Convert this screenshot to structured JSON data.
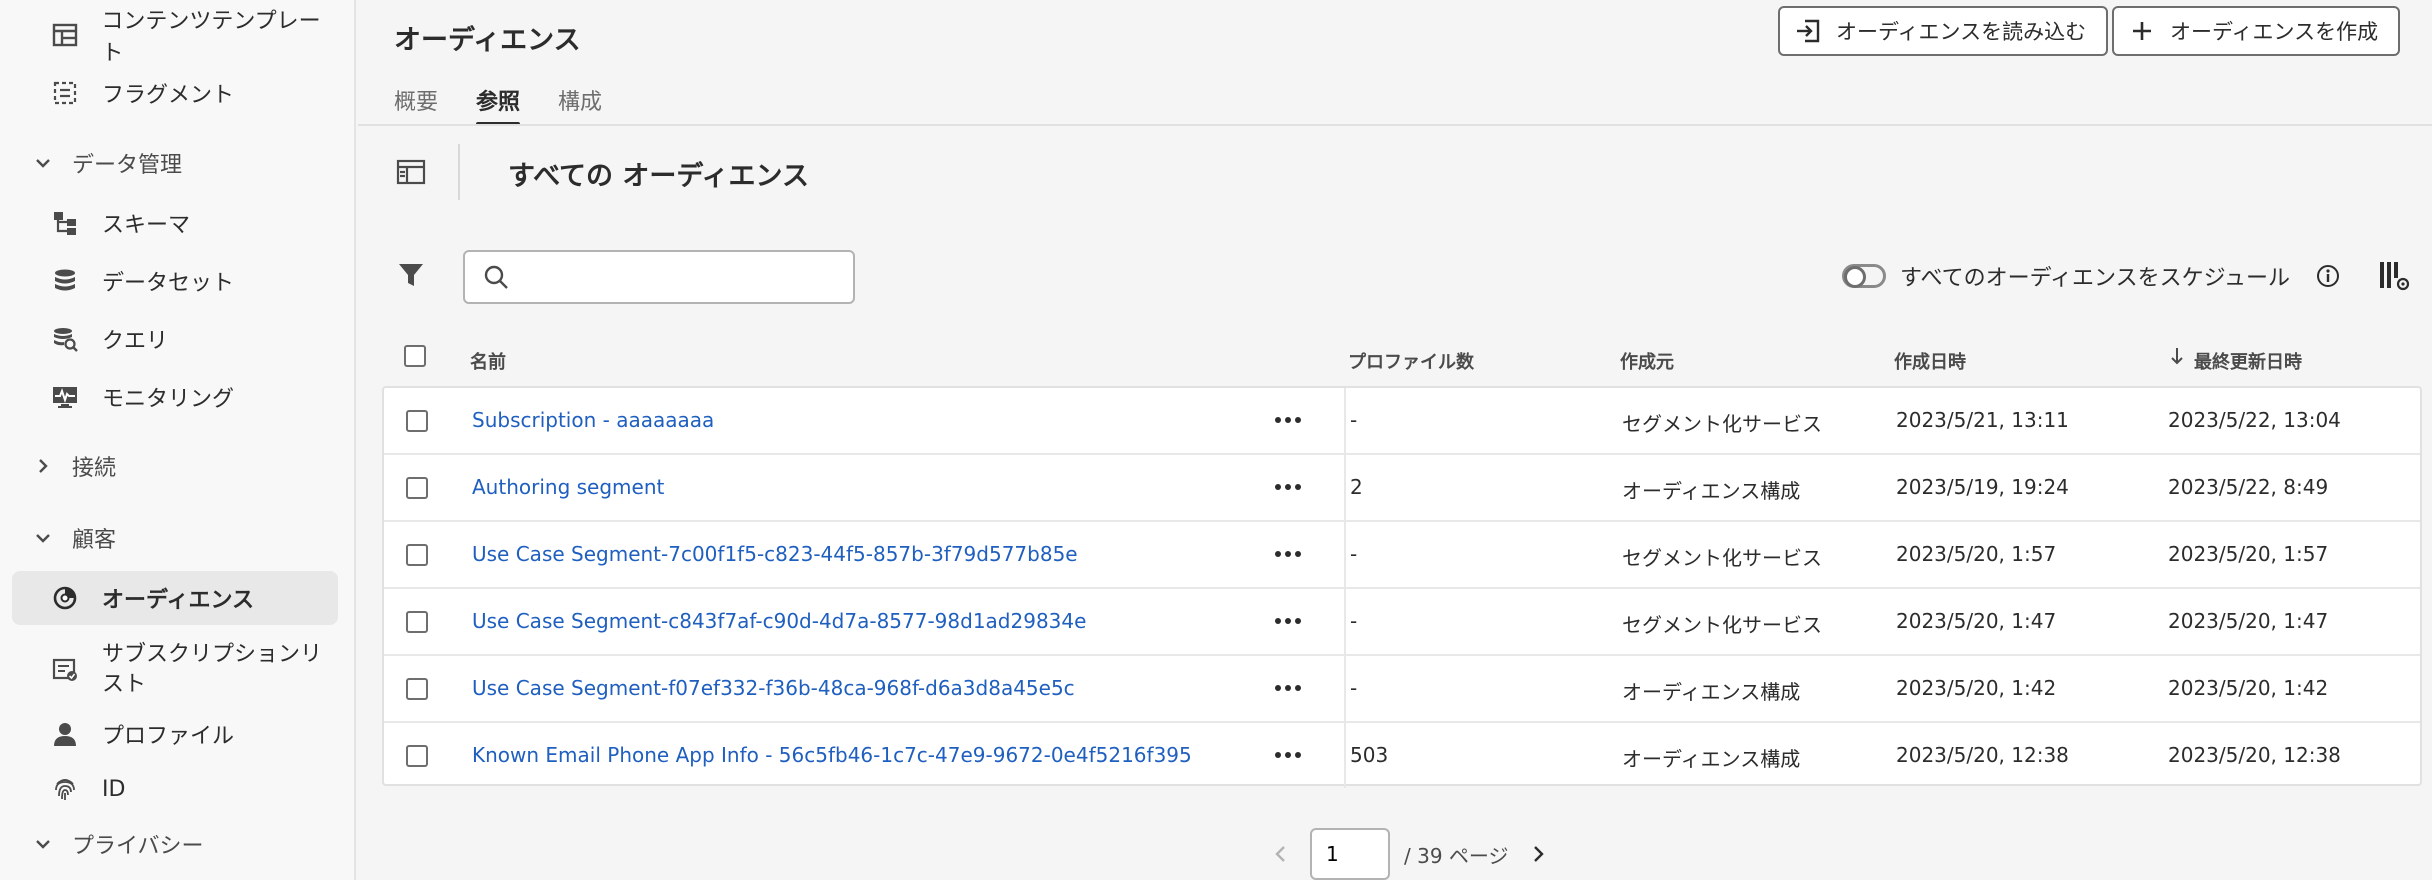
{
  "sidebar": {
    "items": [
      {
        "id": "content-templates",
        "label": "コンテンツテンプレート"
      },
      {
        "id": "fragments",
        "label": "フラグメント"
      },
      {
        "id": "section-data",
        "label": "データ管理"
      },
      {
        "id": "schemas",
        "label": "スキーマ"
      },
      {
        "id": "datasets",
        "label": "データセット"
      },
      {
        "id": "queries",
        "label": "クエリ"
      },
      {
        "id": "monitoring",
        "label": "モニタリング"
      },
      {
        "id": "section-connections",
        "label": "接続"
      },
      {
        "id": "section-customer",
        "label": "顧客"
      },
      {
        "id": "audiences",
        "label": "オーディエンス"
      },
      {
        "id": "subscription-lists",
        "label": "サブスクリプションリスト"
      },
      {
        "id": "profiles",
        "label": "プロファイル"
      },
      {
        "id": "identities",
        "label": "ID"
      },
      {
        "id": "section-privacy",
        "label": "プライバシー"
      }
    ]
  },
  "header": {
    "title": "オーディエンス",
    "import_button": "オーディエンスを読み込む",
    "create_button": "オーディエンスを作成"
  },
  "tabs": [
    {
      "label": "概要",
      "active": false
    },
    {
      "label": "参照",
      "active": true
    },
    {
      "label": "構成",
      "active": false
    }
  ],
  "toolbar": {
    "section_title": "すべての オーディエンス",
    "search_placeholder": "",
    "schedule_label": "すべてのオーディエンスをスケジュール"
  },
  "table": {
    "columns": {
      "name": "名前",
      "profiles": "プロファイル数",
      "origin": "作成元",
      "created": "作成日時",
      "updated": "最終更新日時"
    },
    "rows": [
      {
        "name": "Subscription - aaaaaaaa",
        "profiles": "-",
        "origin": "セグメント化サービス",
        "created": "2023/5/21, 13:11",
        "updated": "2023/5/22, 13:04"
      },
      {
        "name": "Authoring segment",
        "profiles": "2",
        "origin": "オーディエンス構成",
        "created": "2023/5/19, 19:24",
        "updated": "2023/5/22, 8:49"
      },
      {
        "name": "Use Case Segment-7c00f1f5-c823-44f5-857b-3f79d577b85e",
        "profiles": "-",
        "origin": "セグメント化サービス",
        "created": "2023/5/20, 1:57",
        "updated": "2023/5/20, 1:57"
      },
      {
        "name": "Use Case Segment-c843f7af-c90d-4d7a-8577-98d1ad29834e",
        "profiles": "-",
        "origin": "セグメント化サービス",
        "created": "2023/5/20, 1:47",
        "updated": "2023/5/20, 1:47"
      },
      {
        "name": "Use Case Segment-f07ef332-f36b-48ca-968f-d6a3d8a45e5c",
        "profiles": "-",
        "origin": "オーディエンス構成",
        "created": "2023/5/20, 1:42",
        "updated": "2023/5/20, 1:42"
      },
      {
        "name": "Known Email Phone App Info - 56c5fb46-1c7c-47e9-9672-0e4f5216f395",
        "profiles": "503",
        "origin": "オーディエンス構成",
        "created": "2023/5/20, 12:38",
        "updated": "2023/5/20, 12:38"
      }
    ]
  },
  "pagination": {
    "current": "1",
    "total": "/ 39 ページ"
  },
  "colors": {
    "link": "#1f5fbf",
    "text": "#2c2c2c",
    "border": "#e1e1e1",
    "background": "#f5f5f5"
  }
}
